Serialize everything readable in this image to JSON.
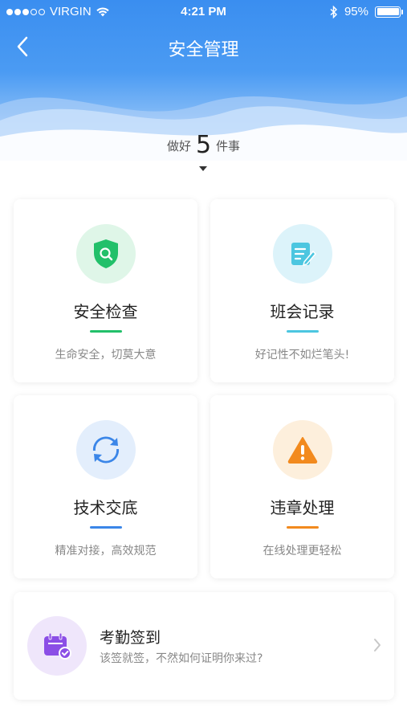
{
  "status_bar": {
    "carrier": "VIRGIN",
    "time": "4:21 PM",
    "battery": "95%",
    "signal_bars_filled": 3,
    "signal_bars_total": 5
  },
  "header": {
    "title": "安全管理",
    "tasks_prefix": "做好",
    "tasks_count": "5",
    "tasks_suffix": "件事"
  },
  "cards": [
    {
      "title": "安全检查",
      "subtitle": "生命安全，切莫大意",
      "icon": "shield-search-icon",
      "accent": "#22c06a",
      "circle_bg": "#dff6e8"
    },
    {
      "title": "班会记录",
      "subtitle": "好记性不如烂笔头!",
      "icon": "notepad-edit-icon",
      "accent": "#4cc6e0",
      "circle_bg": "#dcf3fa"
    },
    {
      "title": "技术交底",
      "subtitle": "精准对接，高效规范",
      "icon": "sync-arrows-icon",
      "accent": "#3b86e8",
      "circle_bg": "#e3eefc"
    },
    {
      "title": "违章处理",
      "subtitle": "在线处理更轻松",
      "icon": "warning-icon",
      "accent": "#f28a1e",
      "circle_bg": "#fdefdc"
    }
  ],
  "attendance": {
    "title": "考勤签到",
    "subtitle": "该签就签，不然如何证明你来过?",
    "icon": "calendar-check-icon",
    "accent": "#8b4ee6"
  }
}
